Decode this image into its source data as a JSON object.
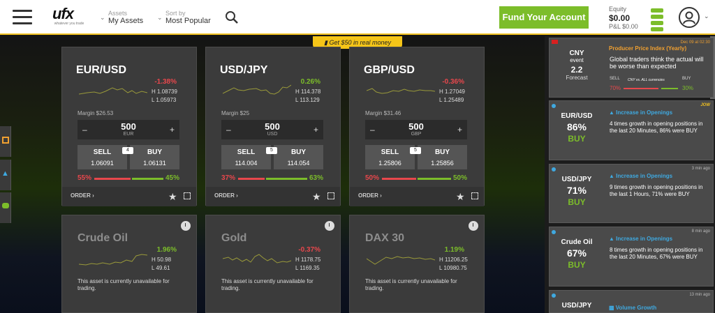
{
  "header": {
    "logo": "ufx",
    "logo_tag": "whatever you trade",
    "assets_label": "Assets",
    "assets_value": "My Assets",
    "sort_label": "Sort by",
    "sort_value": "Most Popular",
    "fund_button": "Fund Your Account",
    "equity_label": "Equity",
    "equity_value": "$0.00",
    "pl_label": "P&L $0.00"
  },
  "promo": "Get $50 in real money",
  "cards": [
    {
      "pair": "EUR/USD",
      "change": "-1.38%",
      "high": "H 1.08739",
      "low": "L 1.05973",
      "margin": "Margin $26.53",
      "qty": "500",
      "ccy": "EUR",
      "sell": "SELL",
      "buy": "BUY",
      "spread": "4",
      "sell_price": "1.06091",
      "buy_price": "1.06131",
      "sell_pct": "55%",
      "buy_pct": "45%",
      "order": "ORDER"
    },
    {
      "pair": "USD/JPY",
      "change": "0.26%",
      "high": "H 114.378",
      "low": "L 113.129",
      "margin": "Margin $25",
      "qty": "500",
      "ccy": "USD",
      "sell": "SELL",
      "buy": "BUY",
      "spread": "5",
      "sell_price": "114.004",
      "buy_price": "114.054",
      "sell_pct": "37%",
      "buy_pct": "63%",
      "order": "ORDER"
    },
    {
      "pair": "GBP/USD",
      "change": "-0.36%",
      "high": "H 1.27049",
      "low": "L 1.25489",
      "margin": "Margin $31.46",
      "qty": "500",
      "ccy": "GBP",
      "sell": "SELL",
      "buy": "BUY",
      "spread": "5",
      "sell_price": "1.25806",
      "buy_price": "1.25856",
      "sell_pct": "50%",
      "buy_pct": "50%",
      "order": "ORDER"
    },
    {
      "pair": "Crude Oil",
      "change": "1.96%",
      "high": "H 50.98",
      "low": "L 49.61",
      "note": "This asset is currently unavailable for trading."
    },
    {
      "pair": "Gold",
      "change": "-0.37%",
      "high": "H 1178.75",
      "low": "L 1169.35",
      "note": "This asset is currently unavailable for trading."
    },
    {
      "pair": "DAX 30",
      "change": "1.19%",
      "high": "H 11206.25",
      "low": "L 10980.75",
      "note": "This asset is currently unavailable for trading."
    }
  ],
  "colors": {
    "green": "#7cbd2a",
    "red": "#e8474c",
    "blue": "#3fa9e0",
    "accent": "#f5c518"
  },
  "feed": [
    {
      "left1": "CNY",
      "left2": "event",
      "left3": "2.2",
      "left4": "Forecast",
      "time": "Dec 09 at 02:30",
      "title": "Producer Price Index (Yearly)",
      "text": "Global traders think the actual will be worse than expected",
      "sell": "SELL",
      "sell_pct": "70%",
      "vs": "CNY vs. ALL currencies",
      "buy": "BUY",
      "buy_pct": "30%"
    },
    {
      "asset": "EUR/USD",
      "pct": "86%",
      "action": "BUY",
      "badge": "JOW",
      "title": "Increase in Openings",
      "text": "4 times growth in opening positions in the last 20 Minutes, 86% were BUY"
    },
    {
      "asset": "USD/JPY",
      "pct": "71%",
      "action": "BUY",
      "ago": "3 min ago",
      "title": "Increase in Openings",
      "text": "9 times growth in opening positions in the last 1 Hours, 71% were BUY"
    },
    {
      "asset": "Crude Oil",
      "pct": "67%",
      "action": "BUY",
      "ago": "8 min ago",
      "title": "Increase in Openings",
      "text": "8 times growth in opening positions in the last 20 Minutes, 67% were BUY"
    },
    {
      "asset": "USD/JPY",
      "ago": "13 min ago",
      "title": "Volume Growth"
    }
  ]
}
